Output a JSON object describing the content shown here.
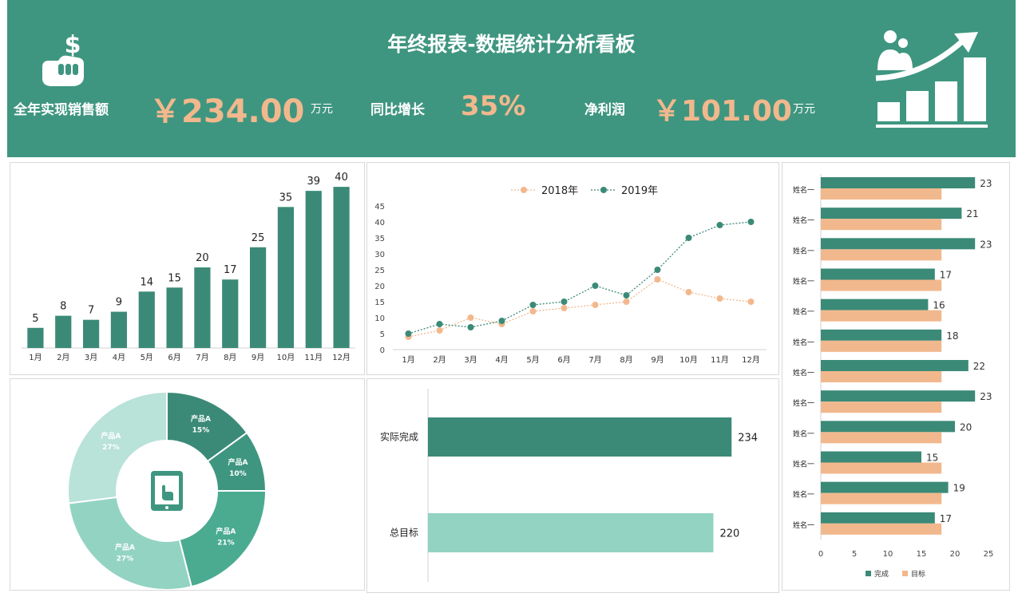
{
  "header": {
    "title": "年终报表-数据统计分析看板",
    "kpis": [
      {
        "label": "全年实现销售额",
        "value": "￥234.00",
        "unit": "万元"
      },
      {
        "label": "同比增长",
        "value": "35%",
        "unit": ""
      },
      {
        "label": "净利润",
        "value": "￥101.00",
        "unit": "万元"
      }
    ],
    "icons": [
      "money-hand-icon",
      "growth-chart-icon"
    ]
  },
  "colors": {
    "header_bg": "#3f9680",
    "accent": "#f2b88d",
    "teal": "#3b8a77",
    "mint": "#93d3c2"
  },
  "chart_data": [
    {
      "type": "bar",
      "categories": [
        "1月",
        "2月",
        "3月",
        "4月",
        "5月",
        "6月",
        "7月",
        "8月",
        "9月",
        "10月",
        "11月",
        "12月"
      ],
      "values": [
        5,
        8,
        7,
        9,
        14,
        15,
        20,
        17,
        25,
        35,
        39,
        40
      ],
      "title": "",
      "xlabel": "",
      "ylabel": "",
      "ylim": [
        0,
        42
      ],
      "show_data_labels": true
    },
    {
      "type": "line",
      "categories": [
        "1月",
        "2月",
        "3月",
        "4月",
        "5月",
        "6月",
        "7月",
        "8月",
        "9月",
        "10月",
        "11月",
        "12月"
      ],
      "series": [
        {
          "name": "2018年",
          "values": [
            4,
            6,
            10,
            8,
            12,
            13,
            14,
            15,
            22,
            18,
            16,
            15
          ],
          "color": "#f2b88d"
        },
        {
          "name": "2019年",
          "values": [
            5,
            8,
            7,
            9,
            14,
            15,
            20,
            17,
            25,
            35,
            39,
            40
          ],
          "color": "#3b8a77"
        }
      ],
      "ylim": [
        0,
        45
      ],
      "yticks": [
        0,
        5,
        10,
        15,
        20,
        25,
        30,
        35,
        40,
        45
      ],
      "legend": "top"
    },
    {
      "type": "bar",
      "orientation": "horizontal",
      "categories": [
        "姓名一",
        "姓名一",
        "姓名一",
        "姓名一",
        "姓名一",
        "姓名一",
        "姓名一",
        "姓名一",
        "姓名一",
        "姓名一",
        "姓名一",
        "姓名一"
      ],
      "series": [
        {
          "name": "完成",
          "values": [
            23,
            21,
            23,
            17,
            16,
            18,
            22,
            23,
            20,
            15,
            19,
            17
          ],
          "color": "#3b8a77"
        },
        {
          "name": "目标",
          "values": [
            18,
            18,
            18,
            18,
            18,
            18,
            18,
            18,
            18,
            18,
            18,
            18
          ],
          "color": "#f2b88d"
        }
      ],
      "xlim": [
        0,
        25
      ],
      "xticks": [
        0,
        5,
        10,
        15,
        20,
        25
      ],
      "legend": "bottom"
    },
    {
      "type": "pie",
      "donut": true,
      "slices": [
        {
          "label": "产品A",
          "percent": "15%",
          "value": 15,
          "color": "#3b8a77"
        },
        {
          "label": "产品A",
          "percent": "10%",
          "value": 10,
          "color": "#3f9680"
        },
        {
          "label": "产品A",
          "percent": "21%",
          "value": 21,
          "color": "#4aab91"
        },
        {
          "label": "产品A",
          "percent": "27%",
          "value": 27,
          "color": "#93d3c2"
        },
        {
          "label": "产品A",
          "percent": "27%",
          "value": 27,
          "color": "#b9e2d8"
        }
      ],
      "center_icon": "tablet-hand-icon"
    },
    {
      "type": "bar",
      "orientation": "horizontal",
      "categories": [
        "实际完成",
        "总目标"
      ],
      "values": [
        234,
        220
      ],
      "colors": [
        "#3b8a77",
        "#93d3c2"
      ],
      "show_data_labels": true
    }
  ]
}
